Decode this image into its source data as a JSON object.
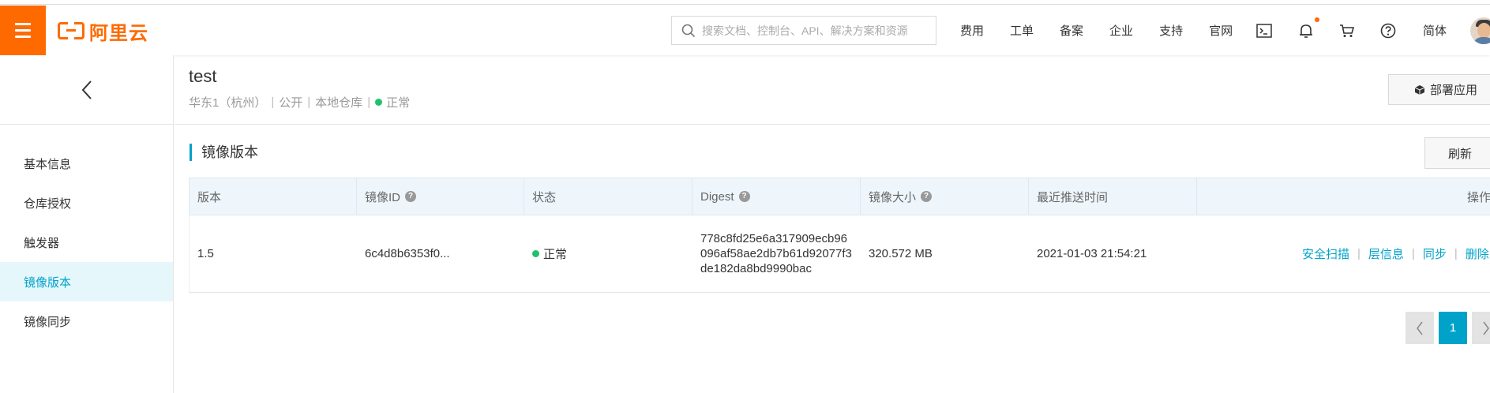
{
  "topbar": {
    "brand": "阿里云",
    "search_placeholder": "搜索文档、控制台、API、解决方案和资源",
    "links": [
      "费用",
      "工单",
      "备案",
      "企业",
      "支持",
      "官网"
    ],
    "language": "简体",
    "icons": [
      "terminal-icon",
      "bell-icon",
      "cart-icon",
      "help-icon"
    ]
  },
  "sidebar": {
    "items": [
      {
        "label": "基本信息",
        "active": false
      },
      {
        "label": "仓库授权",
        "active": false
      },
      {
        "label": "触发器",
        "active": false
      },
      {
        "label": "镜像版本",
        "active": true
      },
      {
        "label": "镜像同步",
        "active": false
      }
    ]
  },
  "repo": {
    "name": "test",
    "region": "华东1（杭州）",
    "visibility": "公开",
    "source": "本地仓库",
    "status": "正常",
    "deploy_label": "部署应用"
  },
  "section": {
    "title": "镜像版本",
    "refresh_label": "刷新"
  },
  "table": {
    "columns": [
      "版本",
      "镜像ID",
      "状态",
      "Digest",
      "镜像大小",
      "最近推送时间",
      "操作"
    ],
    "rows": [
      {
        "version": "1.5",
        "image_id": "6c4d8b6353f0...",
        "status": "正常",
        "digest_lines": [
          "778c8fd25e6a317909ecb96",
          "096af58ae2db7b61d92077f3",
          "de182da8bd9990bac"
        ],
        "size": "320.572 MB",
        "pushed": "2021-01-03 21:54:21",
        "actions": [
          "安全扫描",
          "层信息",
          "同步",
          "删除"
        ]
      }
    ]
  },
  "pagination": {
    "current": "1"
  },
  "colors": {
    "brand": "#ff6a00",
    "accent": "#00a2ca",
    "status_ok": "#1fc26b"
  }
}
